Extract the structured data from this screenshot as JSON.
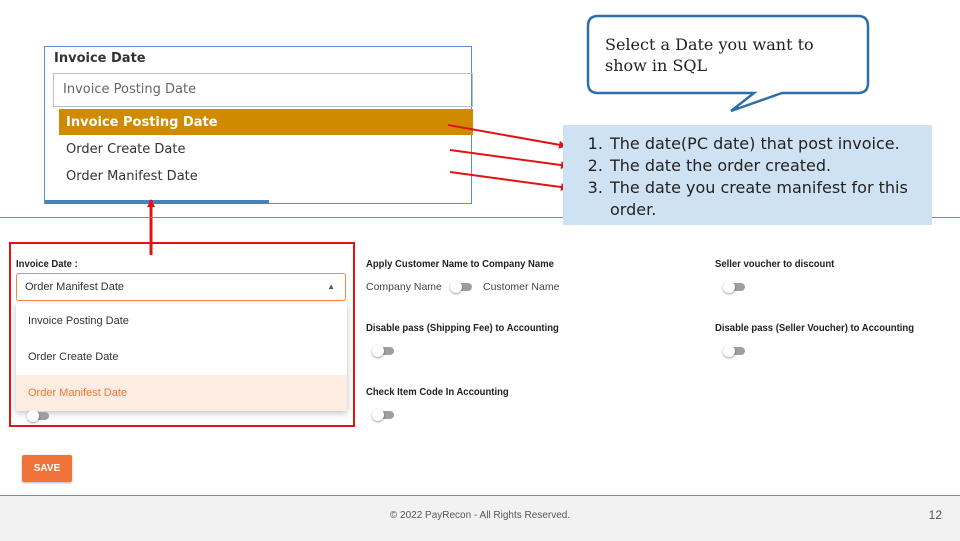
{
  "zoom_dropdown": {
    "title": "Invoice Date",
    "value": "Invoice Posting Date",
    "options": [
      "Invoice Posting Date",
      "Order Create Date",
      "Order Manifest Date"
    ]
  },
  "callout": {
    "text": "Select a Date you want to show in SQL"
  },
  "explanations": [
    "The date(PC date) that post invoice.",
    "The date the order created.",
    "The date you create manifest for this order."
  ],
  "form": {
    "invoice_date_label": "Invoice Date :",
    "invoice_date_value": "Order Manifest Date",
    "invoice_date_options": [
      "Invoice Posting Date",
      "Order Create Date",
      "Order Manifest Date"
    ],
    "apply_customer_label": "Apply Customer Name to Company Name",
    "company_name_label": "Company Name",
    "customer_name_label": "Customer Name",
    "disable_shipping_label": "Disable pass (Shipping Fee) to Accounting",
    "check_item_label": "Check Item Code In Accounting",
    "seller_voucher_label": "Seller voucher to discount",
    "disable_seller_label": "Disable pass (Seller Voucher) to Accounting",
    "save_label": "SAVE"
  },
  "footer": {
    "copyright": "© 2022 PayRecon - All Rights Reserved.",
    "page_number": "12"
  },
  "colors": {
    "accent_orange": "#f0733a",
    "highlight_red": "#e01414",
    "selected_option": "#d08a00",
    "callout_border": "#2f6fa8",
    "explain_bg": "#cfe2f3"
  }
}
